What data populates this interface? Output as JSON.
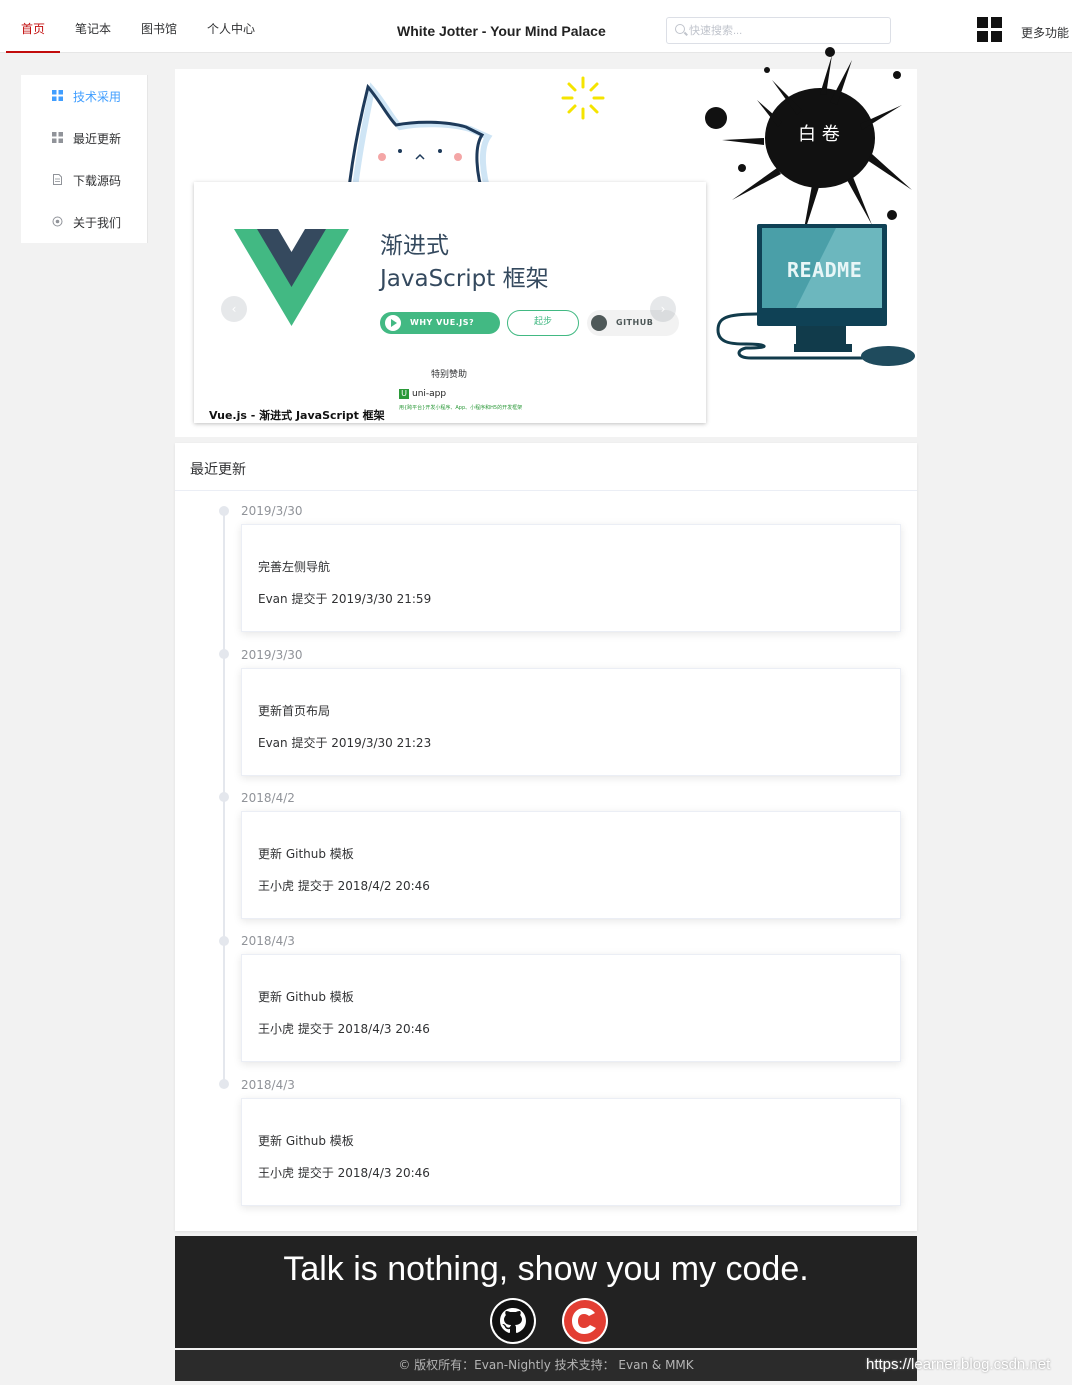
{
  "nav": {
    "tabs": [
      {
        "label": "首页",
        "active": true
      },
      {
        "label": "笔记本"
      },
      {
        "label": "图书馆"
      },
      {
        "label": "个人中心"
      }
    ],
    "title": "White Jotter - Your Mind Palace",
    "search_placeholder": "快速搜索...",
    "more_label": "更多功能"
  },
  "sidebar": {
    "items": [
      {
        "label": "技术采用",
        "icon": "grid-icon",
        "active": true
      },
      {
        "label": "最近更新",
        "icon": "grid-icon"
      },
      {
        "label": "下载源码",
        "icon": "document-icon"
      },
      {
        "label": "关于我们",
        "icon": "settings-icon"
      }
    ]
  },
  "carousel": {
    "tagline_line1": "渐进式",
    "tagline_line2": "JavaScript 框架",
    "why_button": "WHY VUE.JS?",
    "start_button": "起步",
    "github_button": "GITHUB",
    "sponsor_label": "特别赞助",
    "sponsor_name": "uni-app",
    "sponsor_subtitle": "用{跨平台}开发小程序、App、小程序和H5的开发框架",
    "caption": "Vue.js - 渐进式 JavaScript 框架",
    "prev_arrow": "‹",
    "next_arrow": "›",
    "accent": "#42b983",
    "dark": "#34495e"
  },
  "decor": {
    "splash_text": "白 卷",
    "readme_text": "README"
  },
  "updates": {
    "title": "最近更新",
    "items": [
      {
        "date": "2019/3/30",
        "title": "完善左侧导航",
        "meta": "Evan 提交于 2019/3/30 21:59"
      },
      {
        "date": "2019/3/30",
        "title": "更新首页布局",
        "meta": "Evan 提交于 2019/3/30 21:23"
      },
      {
        "date": "2018/4/2",
        "title": "更新 Github 模板",
        "meta": "王小虎 提交于 2018/4/2 20:46"
      },
      {
        "date": "2018/4/3",
        "title": "更新 Github 模板",
        "meta": "王小虎 提交于 2018/4/3 20:46"
      },
      {
        "date": "2018/4/3",
        "title": "更新 Github 模板",
        "meta": "王小虎 提交于 2018/4/3 20:46"
      }
    ]
  },
  "footer": {
    "slogan": "Talk is nothing, show you my code.",
    "copyright": "© 版权所有：Evan-Nightly   技术支持：  Evan & MMK",
    "watermark": "https://learner.blog.csdn.net"
  }
}
